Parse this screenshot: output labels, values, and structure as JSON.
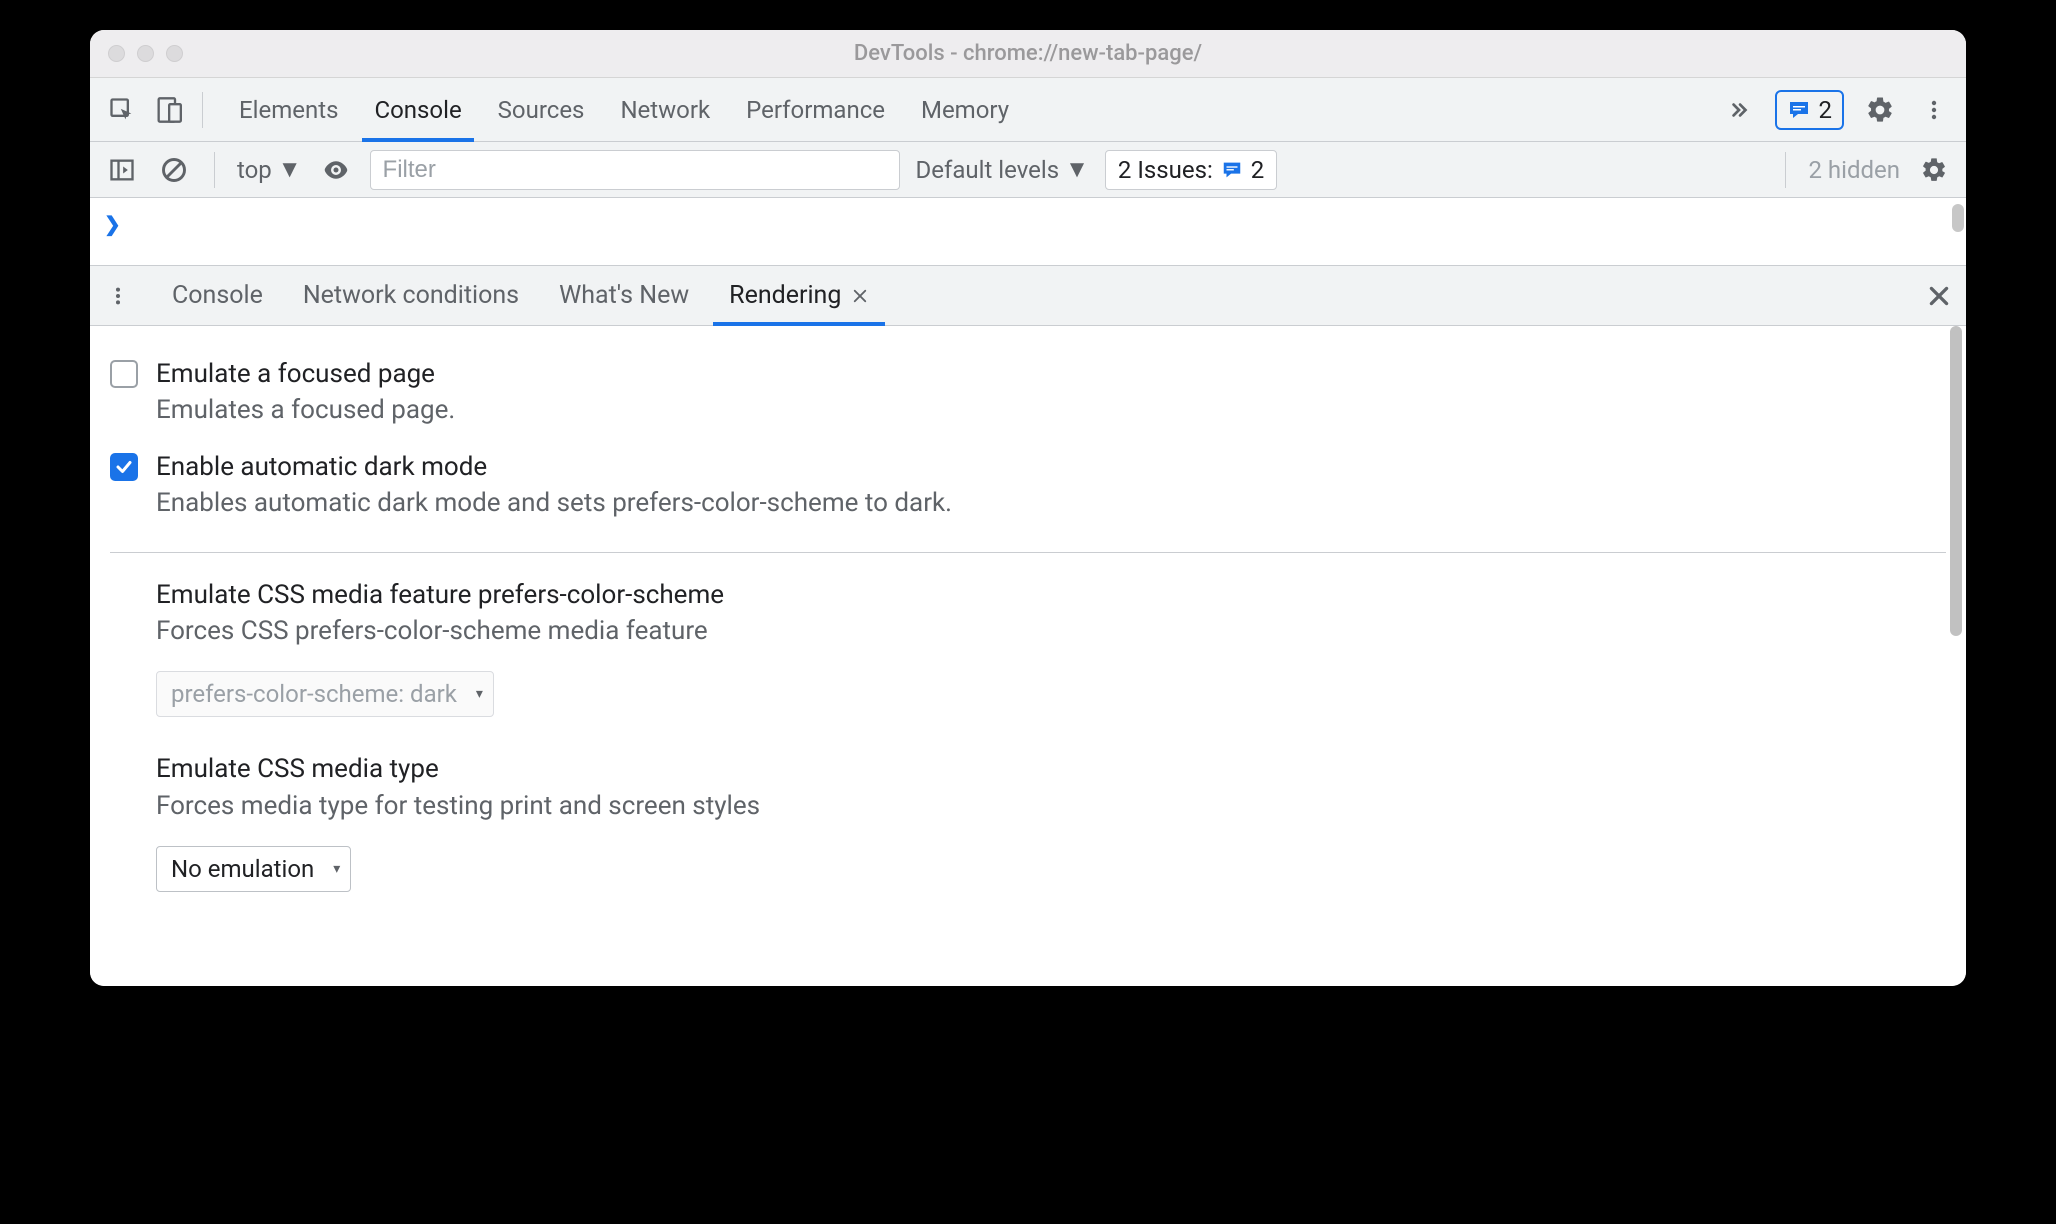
{
  "window": {
    "title": "DevTools - chrome://new-tab-page/"
  },
  "mainTabs": {
    "elements": "Elements",
    "console": "Console",
    "sources": "Sources",
    "network": "Network",
    "performance": "Performance",
    "memory": "Memory"
  },
  "issuesBadge": {
    "count": "2"
  },
  "consoleToolbar": {
    "context": "top",
    "filterPlaceholder": "Filter",
    "levels": "Default levels",
    "issuesLabel": "2 Issues:",
    "issuesCount": "2",
    "hidden": "2 hidden"
  },
  "drawerTabs": {
    "console": "Console",
    "networkConditions": "Network conditions",
    "whatsNew": "What's New",
    "rendering": "Rendering"
  },
  "rendering": {
    "emulateFocused": {
      "label": "Emulate a focused page",
      "desc": "Emulates a focused page.",
      "checked": false
    },
    "autoDarkMode": {
      "label": "Enable automatic dark mode",
      "desc": "Enables automatic dark mode and sets prefers-color-scheme to dark.",
      "checked": true
    },
    "prefersColorScheme": {
      "label": "Emulate CSS media feature prefers-color-scheme",
      "desc": "Forces CSS prefers-color-scheme media feature",
      "value": "prefers-color-scheme: dark"
    },
    "mediaType": {
      "label": "Emulate CSS media type",
      "desc": "Forces media type for testing print and screen styles",
      "value": "No emulation"
    }
  }
}
